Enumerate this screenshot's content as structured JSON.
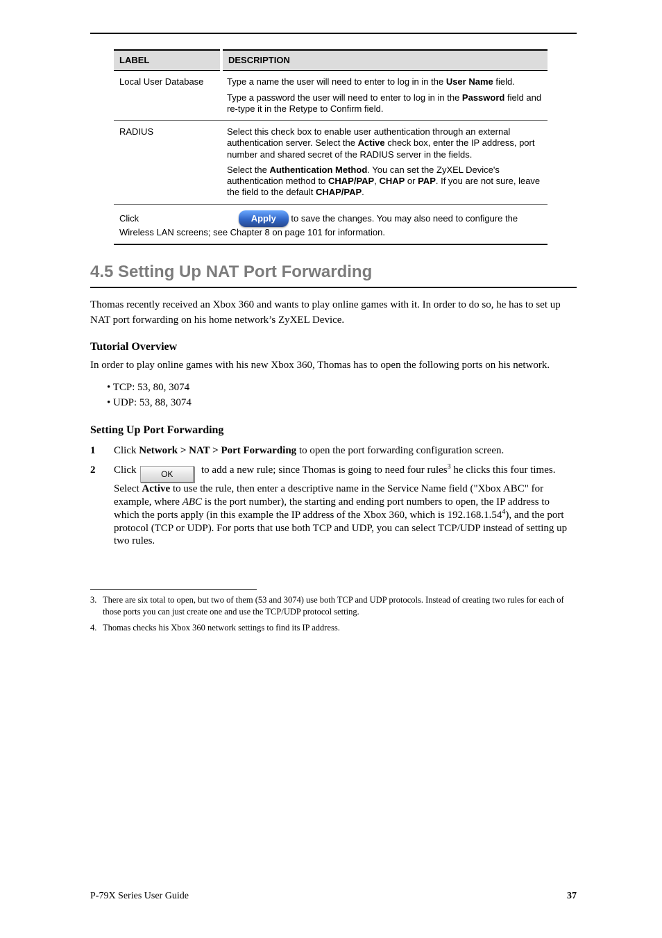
{
  "table": {
    "header": {
      "label": "LABEL",
      "desc": "DESCRIPTION"
    },
    "rows": [
      {
        "label": "Local User Database",
        "desc_a": "Type a name the user will need to enter to log in in the ",
        "desc_b": "User Name",
        "desc_c": " field.",
        "desc_d": "Type a password the user will need to enter to log in in the ",
        "desc_e": "Password",
        "desc_f": " field and re-type it in the Retype to Confirm field."
      },
      {
        "label": "RADIUS",
        "desc_a": "Select this check box to enable user authentication through an external authentication server. Select the ",
        "desc_b": "Active",
        "desc_c": " check box, enter the IP address, port number and shared secret of the RADIUS server in the fields. ",
        "desc_d": "Select the ",
        "desc_e": "Authentication Method",
        "desc_f": ". You can set the ZyXEL Device's authentication method to ",
        "desc_g": "CHAP/PAP",
        "desc_h": ", ",
        "desc_i": "CHAP",
        "desc_j": " or ",
        "desc_k": "PAP",
        "desc_l": ". If you are not sure, leave the field to the default ",
        "desc_m": "CHAP/PAP",
        "desc_n": "."
      }
    ],
    "apply": {
      "pre": "Click ",
      "btn": "Apply",
      "post": " to save the changes.  You may also need to configure the Wireless LAN screens; see Chapter 8 on page 101 for information."
    }
  },
  "section": {
    "title": "4.5  Setting Up NAT Port Forwarding",
    "intro_a": "Thomas recently received an Xbox 360 and wants to play online games with it. In order to do so, he has to set up NAT port forwarding on his home network’s ZyXEL Device.",
    "intro_b": "In order to play online games with his new Xbox 360, Thomas has to open the following ports on his network.",
    "ports": "• TCP: 53, 80, 3074\n• UDP: 53, 88, 3074",
    "step1": {
      "num": "1",
      "pre": "Click ",
      "bold": "Network > NAT > Port Forwarding",
      "post": " to open the port forwarding configuration screen."
    },
    "step2": {
      "num": "2",
      "a": "Click ",
      "ok": "OK",
      "b": "  to add a new rule; since Thomas is going to need four rules",
      "fn": "3",
      "c": " he clicks this four times. Select ",
      "d": "Active",
      "e": " to use the rule, then enter a descriptive name in the Service Name field (\"Xbox ABC\" for example, where ",
      "f": "ABC",
      "g": " is the port number), the starting and ending port numbers to open, the IP address to which the ports apply (in this example the IP address of the Xbox 360, which is 192.168.1.54",
      "fn2": "4",
      "h": "), and the port protocol (TCP or UDP). For ports that use both TCP and UDP, you can select TCP/UDP instead of setting up two rules."
    }
  },
  "footnotes": [
    {
      "n": "3.",
      "t": "There are six total to open, but two of them (53 and 3074) use both TCP and UDP protocols. Instead of creating two rules for each of those ports you can just create one and use the TCP/UDP protocol setting."
    },
    {
      "n": "4.",
      "t": "Thomas checks his Xbox 360 network settings to find its IP address."
    }
  ],
  "footer": {
    "left": "P-79X Series User Guide",
    "right": "37"
  }
}
